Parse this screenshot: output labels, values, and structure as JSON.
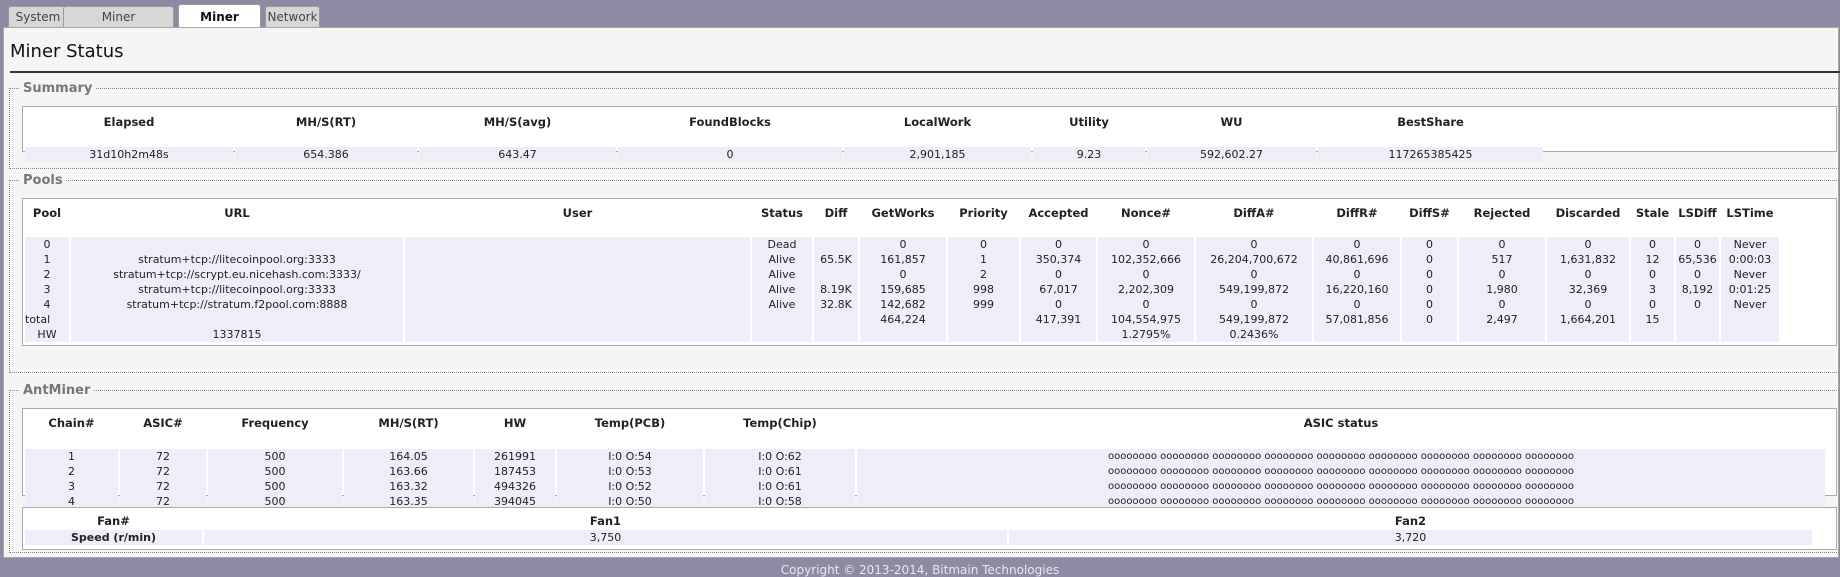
{
  "tabs": [
    {
      "label": "System",
      "active": false
    },
    {
      "label": "Miner Configuration",
      "active": false
    },
    {
      "label": "Miner Status",
      "active": true
    },
    {
      "label": "Network",
      "active": false
    }
  ],
  "page_title": "Miner Status",
  "summary": {
    "legend": "Summary",
    "headers": [
      "Elapsed",
      "MH/S(RT)",
      "MH/S(avg)",
      "FoundBlocks",
      "LocalWork",
      "Utility",
      "WU",
      "BestShare"
    ],
    "row": [
      "31d10h2m48s",
      "654.386",
      "643.47",
      "0",
      "2,901,185",
      "9.23",
      "592,602.27",
      "117265385425"
    ]
  },
  "pools": {
    "legend": "Pools",
    "headers": [
      "Pool",
      "URL",
      "User",
      "Status",
      "Diff",
      "GetWorks",
      "Priority",
      "Accepted",
      "Nonce#",
      "DiffA#",
      "DiffR#",
      "DiffS#",
      "Rejected",
      "Discarded",
      "Stale",
      "LSDiff",
      "LSTime"
    ],
    "rows": [
      [
        "0",
        "",
        "",
        "Dead",
        "",
        "0",
        "0",
        "0",
        "0",
        "0",
        "0",
        "0",
        "0",
        "0",
        "0",
        "0",
        "Never"
      ],
      [
        "1",
        "stratum+tcp://litecoinpool.org:3333",
        "",
        "Alive",
        "65.5K",
        "161,857",
        "1",
        "350,374",
        "102,352,666",
        "26,204,700,672",
        "40,861,696",
        "0",
        "517",
        "1,631,832",
        "12",
        "65,536",
        "0:00:03"
      ],
      [
        "2",
        "stratum+tcp://scrypt.eu.nicehash.com:3333/",
        "",
        "Alive",
        "",
        "0",
        "2",
        "0",
        "0",
        "0",
        "0",
        "0",
        "0",
        "0",
        "0",
        "0",
        "Never"
      ],
      [
        "3",
        "stratum+tcp://litecoinpool.org:3333",
        "",
        "Alive",
        "8.19K",
        "159,685",
        "998",
        "67,017",
        "2,202,309",
        "549,199,872",
        "16,220,160",
        "0",
        "1,980",
        "32,369",
        "3",
        "8,192",
        "0:01:25"
      ],
      [
        "4",
        "stratum+tcp://stratum.f2pool.com:8888",
        "",
        "Alive",
        "32.8K",
        "142,682",
        "999",
        "0",
        "0",
        "0",
        "0",
        "0",
        "0",
        "0",
        "0",
        "0",
        "Never"
      ],
      [
        "total",
        "",
        "",
        "",
        "",
        "464,224",
        "",
        "417,391",
        "104,554,975",
        "549,199,872",
        "57,081,856",
        "0",
        "2,497",
        "1,664,201",
        "15",
        "",
        ""
      ],
      [
        "HW",
        "1337815",
        "",
        "",
        "",
        "",
        "",
        "",
        "1.2795%",
        "0.2436%",
        "",
        "",
        "",
        "",
        "",
        "",
        ""
      ]
    ]
  },
  "antminer": {
    "legend": "AntMiner",
    "headers": [
      "Chain#",
      "ASIC#",
      "Frequency",
      "MH/S(RT)",
      "HW",
      "Temp(PCB)",
      "Temp(Chip)",
      "ASIC status"
    ],
    "rows": [
      [
        "1",
        "72",
        "500",
        "164.05",
        "261991",
        "I:0 O:54",
        "I:0 O:62",
        "oooooooo oooooooo oooooooo oooooooo oooooooo oooooooo oooooooo oooooooo oooooooo"
      ],
      [
        "2",
        "72",
        "500",
        "163.66",
        "187453",
        "I:0 O:53",
        "I:0 O:61",
        "oooooooo oooooooo oooooooo oooooooo oooooooo oooooooo oooooooo oooooooo oooooooo"
      ],
      [
        "3",
        "72",
        "500",
        "163.32",
        "494326",
        "I:0 O:52",
        "I:0 O:61",
        "oooooooo oooooooo oooooooo oooooooo oooooooo oooooooo oooooooo oooooooo oooooooo"
      ],
      [
        "4",
        "72",
        "500",
        "163.35",
        "394045",
        "I:0 O:50",
        "I:0 O:58",
        "oooooooo oooooooo oooooooo oooooooo oooooooo oooooooo oooooooo oooooooo oooooooo"
      ]
    ],
    "fan": {
      "headers": [
        "Fan#",
        "Fan1",
        "Fan2"
      ],
      "row_label": "Speed (r/min)",
      "values": [
        "3,750",
        "3,720"
      ]
    }
  },
  "footer": "Copyright © 2013-2014, Bitmain Technologies"
}
